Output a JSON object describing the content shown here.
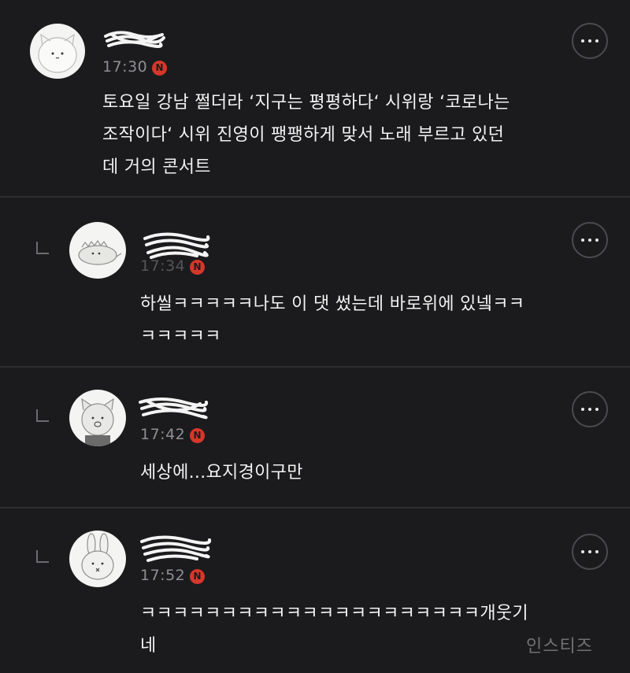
{
  "comments": [
    {
      "time": "17:30",
      "badge": "N",
      "avatar_icon": "cat-face-avatar-icon",
      "text_lines": [
        "토요일 강남 쩔더라 ‘지구는 평평하다‘ 시위랑 ‘코로나는",
        "조작이다‘ 시위 진영이 팽팽하게 맞서 노래 부르고 있던",
        "데 거의 콘서트"
      ]
    },
    {
      "time": "17:34",
      "badge": "N",
      "avatar_icon": "dinosaur-avatar-icon",
      "text_lines": [
        "하씰ㅋㅋㅋㅋㅋ나도 이 댓 썼는데 바로위에 있넼ㅋㅋ",
        "ㅋㅋㅋㅋㅋ"
      ]
    },
    {
      "time": "17:42",
      "badge": "N",
      "avatar_icon": "bear-avatar-icon",
      "text_lines": [
        "세상에...요지경이구만"
      ]
    },
    {
      "time": "17:52",
      "badge": "N",
      "avatar_icon": "rabbit-avatar-icon",
      "text_lines": [
        "ㅋㅋㅋㅋㅋㅋㅋㅋㅋㅋㅋㅋㅋㅋㅋㅋㅋㅋㅋㅋㅋ개웃기",
        "네"
      ]
    }
  ],
  "watermark": "인스티즈",
  "colors": {
    "background": "#1b1b1d",
    "badge": "#d6372b",
    "time": "#8f8f93",
    "text": "#f2f2f2"
  }
}
